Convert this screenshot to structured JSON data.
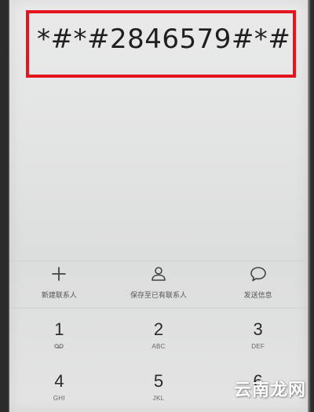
{
  "dialer": {
    "number": "*#*#2846579#*#"
  },
  "actions": [
    {
      "label": "新建联系人",
      "icon": "plus-icon"
    },
    {
      "label": "保存至已有联系人",
      "icon": "person-icon"
    },
    {
      "label": "发送信息",
      "icon": "message-icon"
    }
  ],
  "keypad": [
    {
      "digit": "1",
      "letters": "",
      "icon": "voicemail-icon"
    },
    {
      "digit": "2",
      "letters": "ABC"
    },
    {
      "digit": "3",
      "letters": "DEF"
    },
    {
      "digit": "4",
      "letters": "GHI"
    },
    {
      "digit": "5",
      "letters": "JKL"
    },
    {
      "digit": "6",
      "letters": ""
    }
  ],
  "watermark": "云南龙网"
}
